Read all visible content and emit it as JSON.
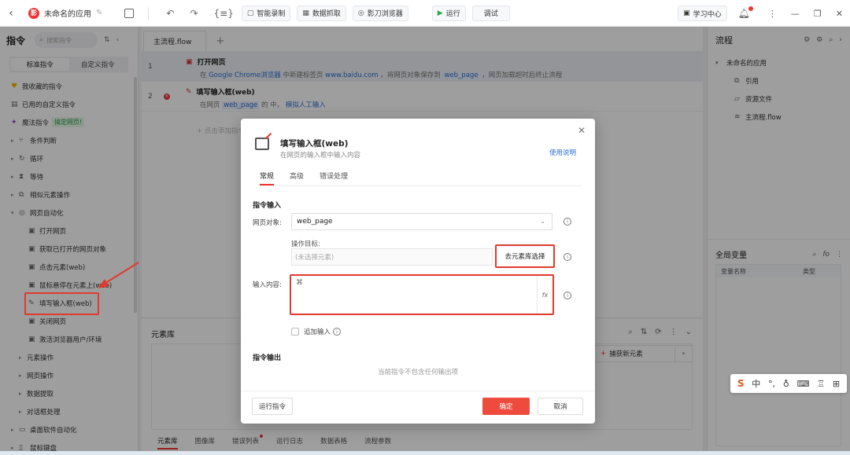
{
  "topbar": {
    "app_title": "未命名的应用",
    "smart_record": "智能录制",
    "data_capture": "数据抓取",
    "browser": "影刀浏览器",
    "run": "运行",
    "debug": "调试",
    "learn_center": "学习中心"
  },
  "left": {
    "heading": "指令",
    "search_placeholder": "搜索指令",
    "seg_standard": "标准指令",
    "seg_custom": "自定义指令",
    "items": [
      {
        "label": "我收藏的指令"
      },
      {
        "label": "已用的自定义指令"
      },
      {
        "label": "魔法指令",
        "badge": "搞定网页!"
      },
      {
        "label": "条件判断"
      },
      {
        "label": "循环"
      },
      {
        "label": "等待"
      },
      {
        "label": "相似元素操作"
      },
      {
        "label": "网页自动化"
      },
      {
        "label": "打开网页"
      },
      {
        "label": "获取已打开的网页对象"
      },
      {
        "label": "点击元素(web)"
      },
      {
        "label": "鼠标悬停在元素上(web)"
      },
      {
        "label": "填写输入框(web)"
      },
      {
        "label": "关闭网页"
      },
      {
        "label": "激活浏览器用户/环境"
      },
      {
        "label": "元素操作"
      },
      {
        "label": "网页操作"
      },
      {
        "label": "数据提取"
      },
      {
        "label": "对话框处理"
      },
      {
        "label": "桌面软件自动化"
      },
      {
        "label": "鼠标键盘"
      }
    ]
  },
  "main": {
    "tab": "主流程.flow",
    "rows": [
      {
        "num": "1",
        "title": "打开网页",
        "d1": "在",
        "d2": "Google Chrome浏览器",
        "d3": "中新建标签页",
        "d4": "www.baidu.com",
        "d5": "，将网页对象保存到",
        "d6": "web_page",
        "d7": "，网页加载超时后终止流程"
      },
      {
        "num": "2",
        "title": "填写输入框(web)",
        "d1": "在网页",
        "d2": "web_page",
        "d3": "的 中，",
        "d4": "模拟人工输入"
      }
    ],
    "add_hint": "+ 点击添加指令"
  },
  "lib": {
    "title": "元素库",
    "capture": "捕获新元素",
    "tabs": [
      "元素库",
      "图像库",
      "错误列表",
      "运行日志",
      "数据表格",
      "流程参数"
    ]
  },
  "right": {
    "heading": "流程",
    "tree_root": "未命名的应用",
    "tree_items": [
      "引用",
      "资源文件",
      "主流程.flow"
    ],
    "global_vars": "全局变量",
    "col_name": "变量名称",
    "col_type": "类型"
  },
  "ime": {
    "s": "S",
    "zh": "中"
  },
  "dialog": {
    "title": "填写输入框(web)",
    "subtitle": "在网页的输入框中输入内容",
    "help": "使用说明",
    "tabs": [
      "常规",
      "高级",
      "错误处理"
    ],
    "input_section": "指令输入",
    "page_label": "网页对象:",
    "page_value": "web_page",
    "target_label": "操作目标:",
    "target_placeholder": "(未选择元素)",
    "pick_button": "去元素库选择",
    "content_label": "输入内容:",
    "append_label": "追加输入",
    "output_section": "指令输出",
    "no_output": "当前指令不包含任何输出项",
    "run_cmd": "运行指令",
    "ok": "确定",
    "cancel": "取消"
  }
}
